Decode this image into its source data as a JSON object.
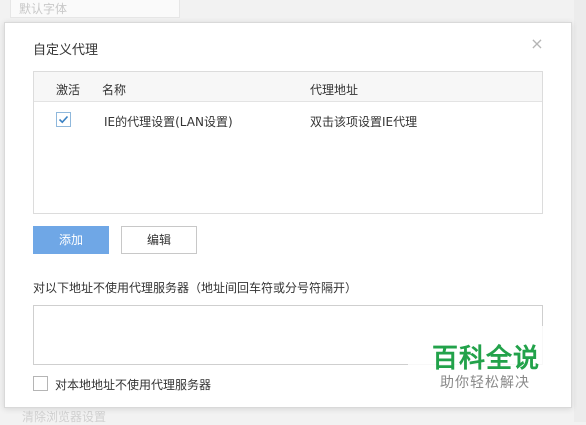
{
  "background": {
    "font_field_text": "默认字体",
    "bottom_link_text": "清除浏览器设置"
  },
  "dialog": {
    "title": "自定义代理",
    "close_icon": "close-icon"
  },
  "table": {
    "headers": {
      "active": "激活",
      "name": "名称",
      "address": "代理地址"
    },
    "rows": [
      {
        "active": true,
        "name": "IE的代理设置(LAN设置)",
        "address": "双击该项设置IE代理"
      }
    ]
  },
  "buttons": {
    "add": "添加",
    "edit": "编辑"
  },
  "bypass": {
    "label": "对以下地址不使用代理服务器（地址间回车符或分号符隔开）",
    "value": ""
  },
  "local_bypass": {
    "checked": false,
    "label": "对本地地址不使用代理服务器"
  },
  "watermark": {
    "title": "百科全说",
    "subtitle": "助你轻松解决"
  },
  "colors": {
    "accent": "#6fa7e6",
    "watermark_green": "#22a24a"
  }
}
